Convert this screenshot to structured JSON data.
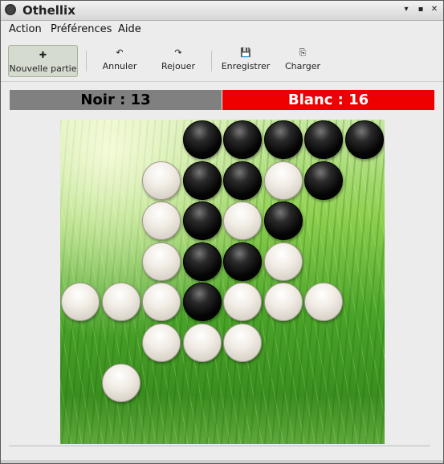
{
  "window": {
    "title": "Othellix",
    "controls": [
      "▾",
      "▪",
      "✕"
    ]
  },
  "menu": [
    {
      "label": "Action",
      "access": "A"
    },
    {
      "label": "Préférences",
      "access": "P"
    },
    {
      "label": "Aide",
      "access": "d"
    }
  ],
  "toolbar": {
    "new_game": {
      "label": "Nouvelle partie",
      "icon": "plus-icon",
      "glyph": "✚"
    },
    "undo": {
      "label": "Annuler",
      "icon": "undo-icon",
      "glyph": "↶"
    },
    "redo": {
      "label": "Rejouer",
      "icon": "redo-icon",
      "glyph": "↷"
    },
    "save": {
      "label": "Enregistrer",
      "icon": "floppy-disk-icon",
      "glyph": "💾"
    },
    "load": {
      "label": "Charger",
      "icon": "load-icon",
      "glyph": "⎘"
    }
  },
  "scores": {
    "black": "Noir : 13",
    "white": "Blanc : 16",
    "black_color": "#808080",
    "white_color": "#ee0000"
  },
  "board": {
    "size": 8,
    "rows": [
      "...BBBBB",
      "..WBBWB.",
      "..WBWB..",
      "..WBBW..",
      "WWWBWWW.",
      "..WWW...",
      ".W......",
      "........"
    ]
  }
}
